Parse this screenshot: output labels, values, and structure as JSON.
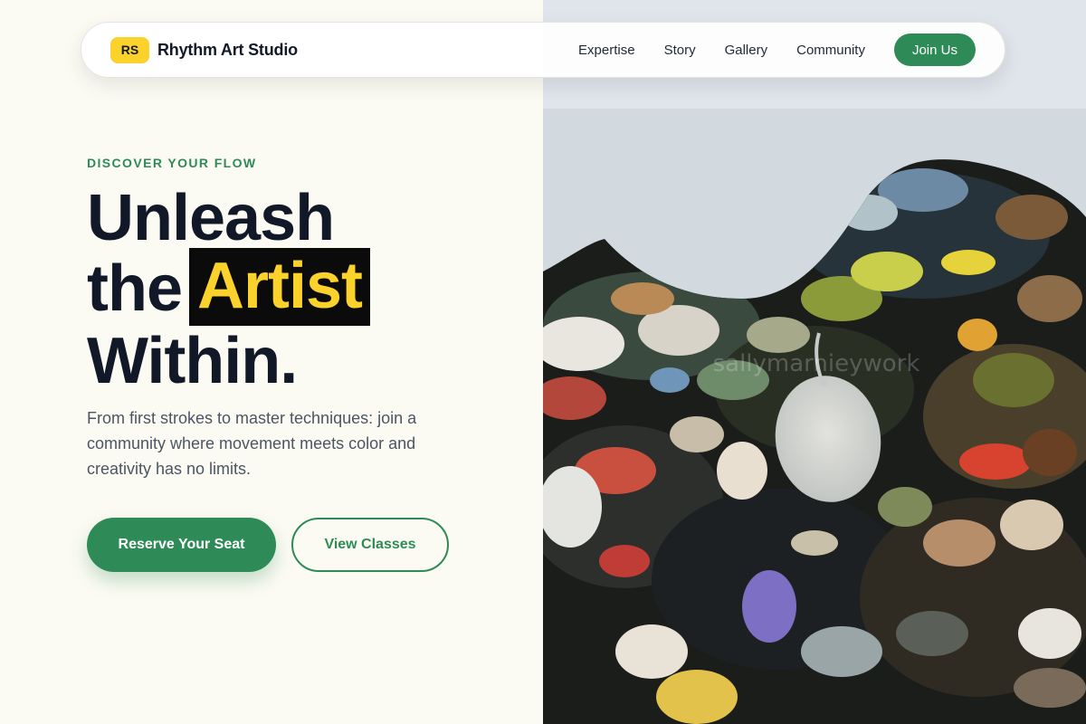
{
  "brand": {
    "logo_initials": "RS",
    "name": "Rhythm Art Studio"
  },
  "nav": {
    "links": [
      "Expertise",
      "Story",
      "Gallery",
      "Community"
    ],
    "join_label": "Join Us"
  },
  "hero": {
    "eyebrow": "DISCOVER YOUR FLOW",
    "headline_line1": "Unleash",
    "headline_line2_prefix": "the",
    "headline_highlight": "Artist",
    "headline_line3": "Within.",
    "subtitle": "From first strokes to master techniques: join a community where movement meets color and creativity has no limits.",
    "primary_cta": "Reserve Your Seat",
    "secondary_cta": "View Classes",
    "image_watermark": "sallymarnieywork"
  },
  "colors": {
    "accent_green": "#2e8b57",
    "accent_yellow": "#fbd22c",
    "text_dark": "#111827",
    "background": "#fcfbf3"
  },
  "icons": {
    "hero_image": "paint-palette-photo"
  }
}
